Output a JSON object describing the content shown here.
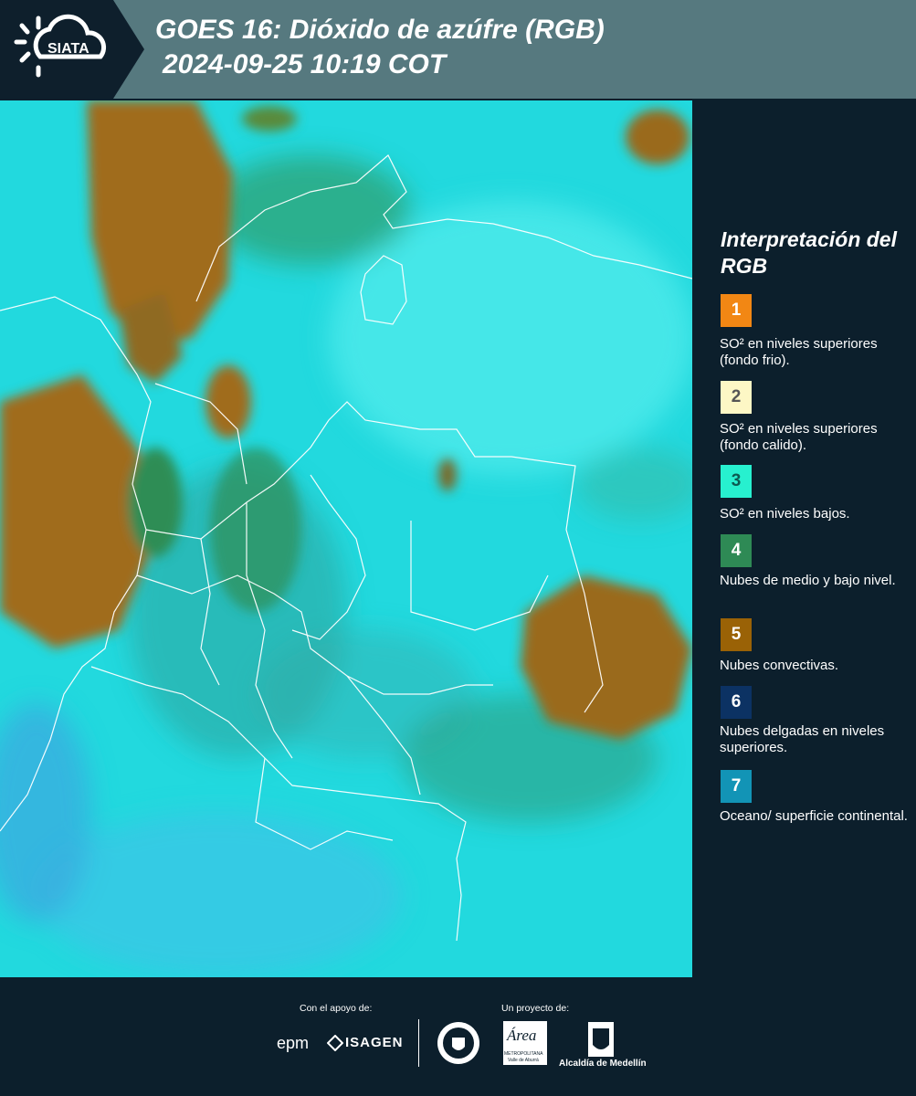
{
  "header": {
    "logo_text": "SIATA",
    "title_line1": "GOES 16: Dióxido de azúfre (RGB)",
    "title_line2": "2024-09-25 10:19 COT"
  },
  "legend": {
    "title": "Interpretación del RGB",
    "items": [
      {
        "num": "1",
        "color": "#f28714",
        "text_color": "#ffffff",
        "label": "SO² en niveles superiores (fondo frio)."
      },
      {
        "num": "2",
        "color": "#fdf7c5",
        "text_color": "#555555",
        "label": "SO² en niveles superiores (fondo calido)."
      },
      {
        "num": "3",
        "color": "#27f0cf",
        "text_color": "#0c5a50",
        "label": "SO² en niveles bajos."
      },
      {
        "num": "4",
        "color": "#2e8a55",
        "text_color": "#ffffff",
        "label": "Nubes de medio y bajo nivel."
      },
      {
        "num": "5",
        "color": "#9a6206",
        "text_color": "#ffffff",
        "label": "Nubes convectivas."
      },
      {
        "num": "6",
        "color": "#0c3263",
        "text_color": "#ffffff",
        "label": "Nubes delgadas en niveles superiores."
      },
      {
        "num": "7",
        "color": "#1294b6",
        "text_color": "#ffffff",
        "label": "Oceano/ superficie continental."
      }
    ]
  },
  "footer": {
    "support_label": "Con el apoyo de:",
    "project_label": "Un proyecto de:",
    "sponsor1": "epm",
    "sponsor2": "ISAGEN",
    "area_name": "Área",
    "area_sub1": "METROPOLITANA",
    "area_sub2": "Valle de Aburrá",
    "alcaldia": "Alcaldía de Medellín"
  }
}
